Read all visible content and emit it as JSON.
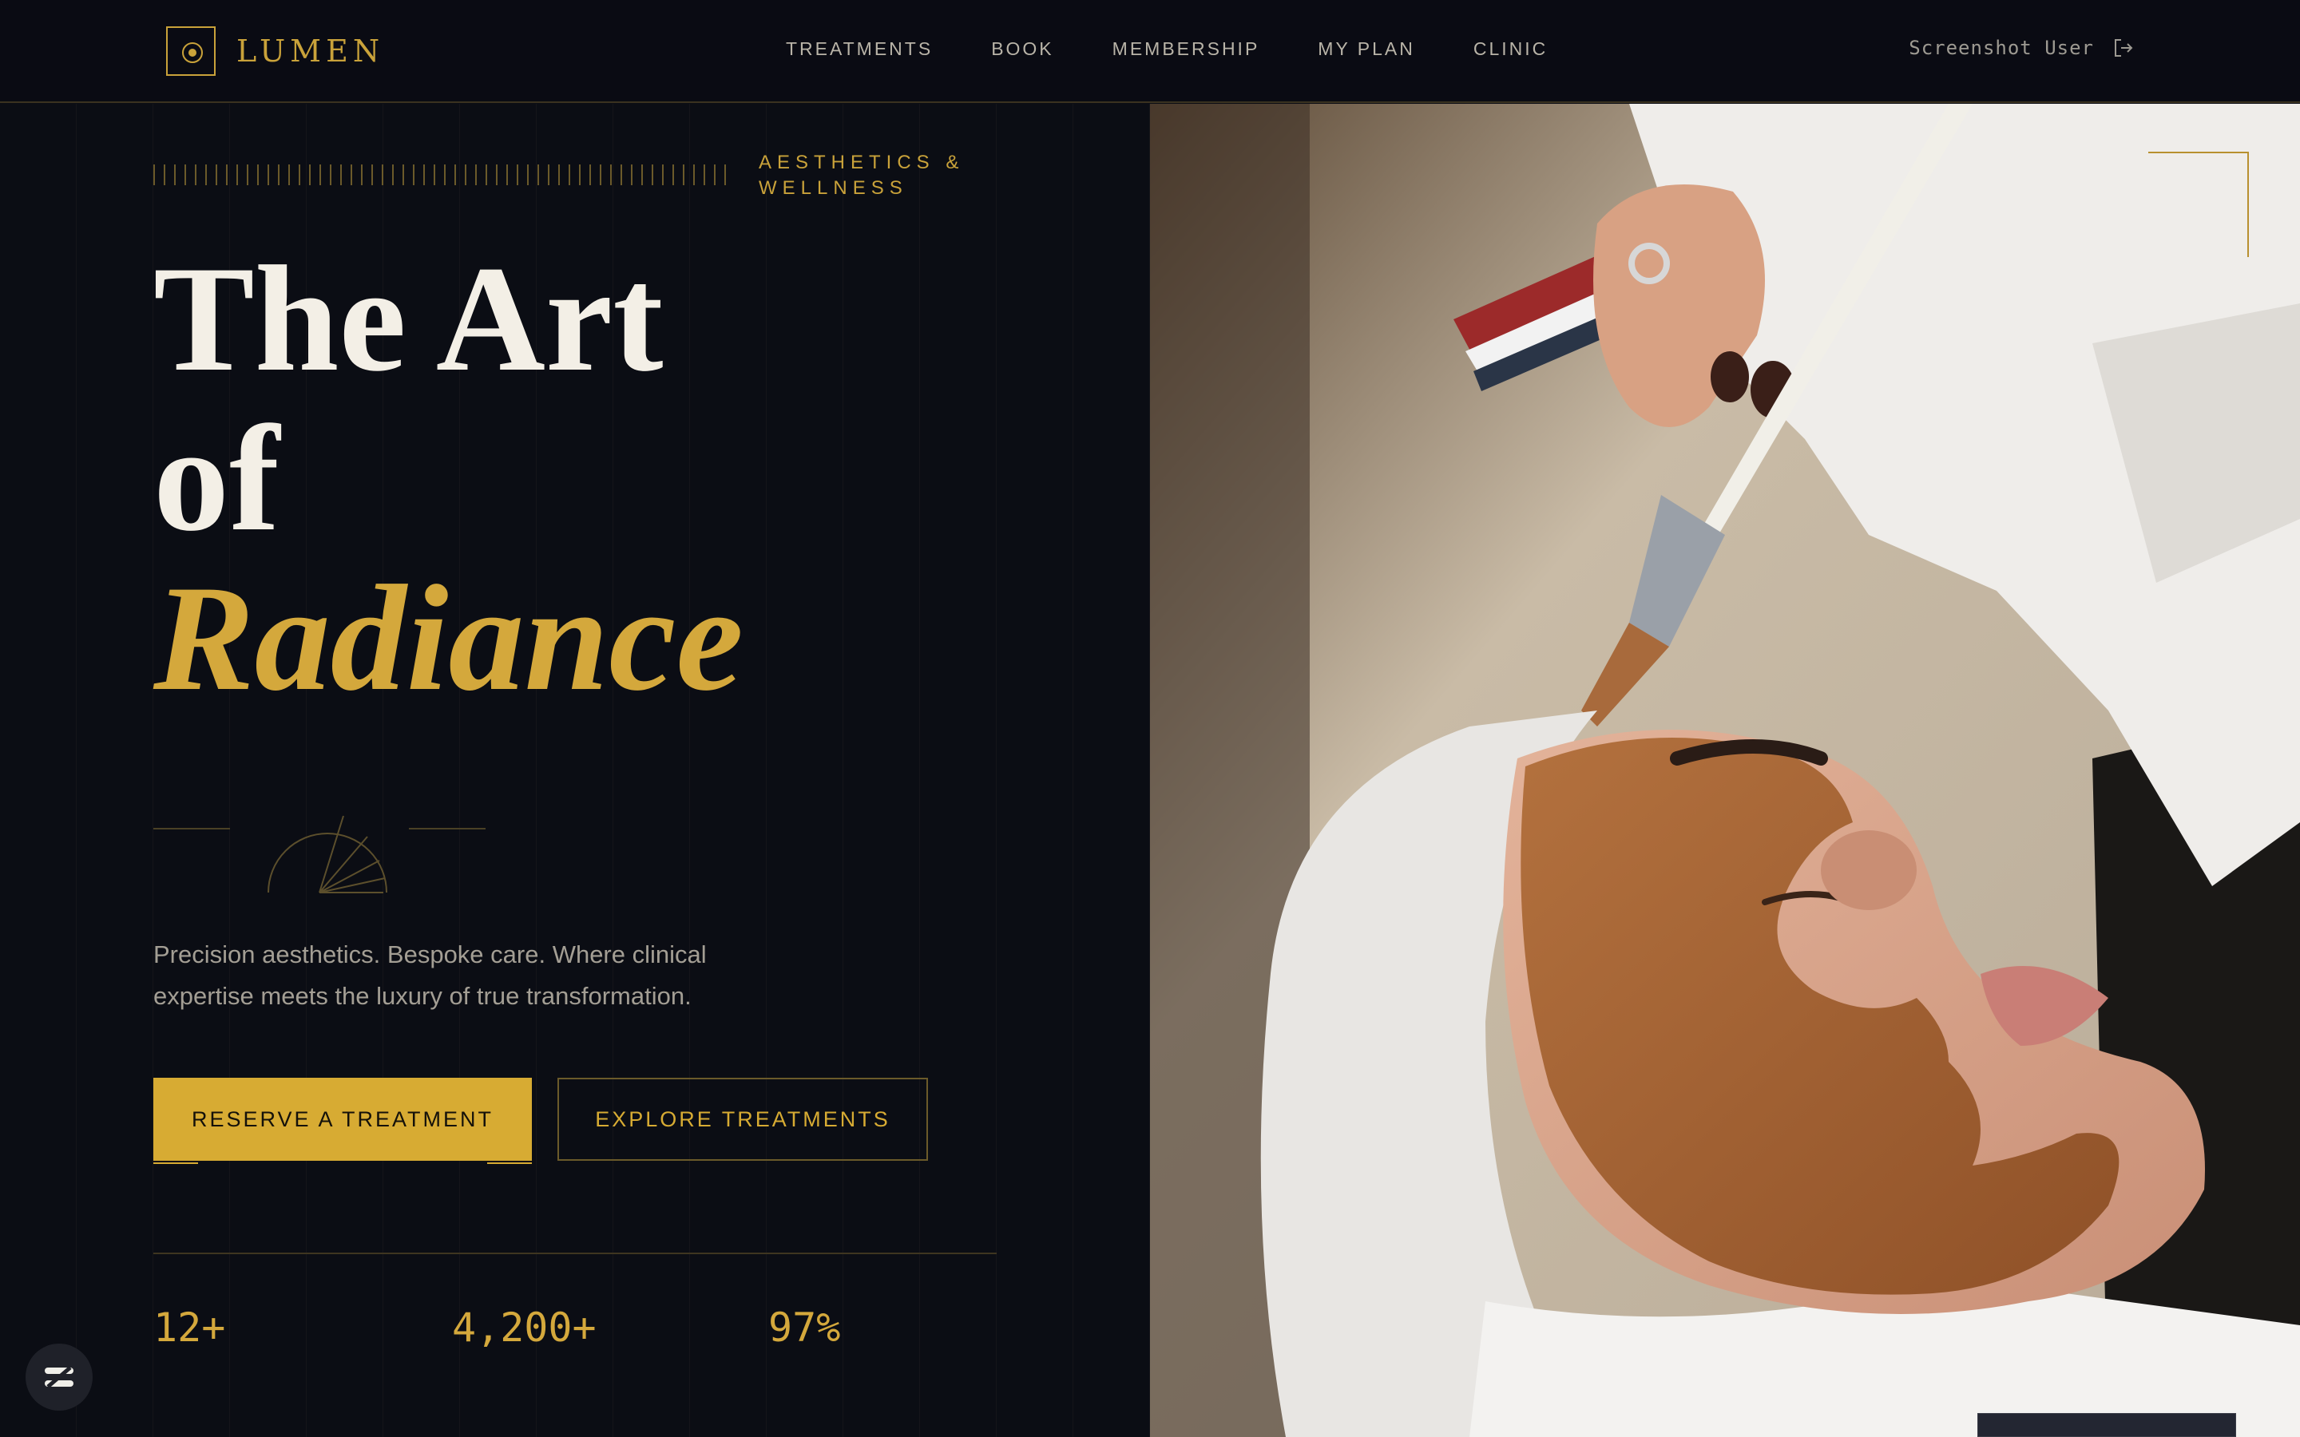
{
  "brand": {
    "name": "LUMEN"
  },
  "nav": {
    "items": [
      "TREATMENTS",
      "BOOK",
      "MEMBERSHIP",
      "MY PLAN",
      "CLINIC"
    ],
    "user": "Screenshot User"
  },
  "hero": {
    "eyebrow": "AESTHETICS & WELLNESS",
    "title_line1": "The Art",
    "title_line2": "of",
    "title_accent": "Radiance",
    "description": "Precision aesthetics. Bespoke care. Where clinical expertise meets the luxury of true transformation.",
    "primary_cta": "RESERVE A TREATMENT",
    "secondary_cta": "EXPLORE TREATMENTS"
  },
  "stats": [
    "12+",
    "4,200+",
    "97%"
  ],
  "colors": {
    "gold": "#d7ab33",
    "background": "#0b0d14",
    "nav": "#0a0b13"
  },
  "icons": [
    "logo-icon",
    "logout-icon",
    "sunburst-ornament-icon",
    "assistant-badge-icon"
  ]
}
